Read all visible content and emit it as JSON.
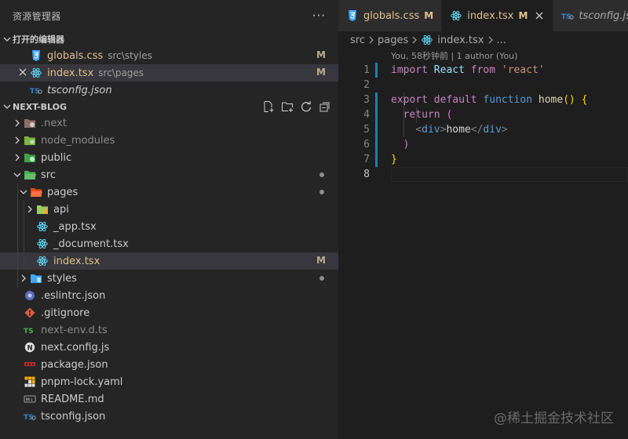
{
  "explorer": {
    "title": "资源管理器",
    "more": "···",
    "open_editors": {
      "label": "打开的编辑器",
      "items": [
        {
          "name": "globals.css",
          "desc": "src\\styles",
          "badge": "M",
          "icon": "css-file-icon"
        },
        {
          "name": "index.tsx",
          "desc": "src\\pages",
          "badge": "M",
          "icon": "react-file-icon"
        },
        {
          "name": "tsconfig.json",
          "desc": "",
          "badge": "",
          "icon": "ts-config-file-icon"
        }
      ]
    },
    "project": {
      "label": "NEXT-BLOG",
      "tree": [
        {
          "name": ".next",
          "kind": "folder"
        },
        {
          "name": "node_modules",
          "kind": "folder"
        },
        {
          "name": "public",
          "kind": "folder"
        },
        {
          "name": "src",
          "kind": "folder"
        },
        {
          "name": "pages",
          "kind": "folder"
        },
        {
          "name": "api",
          "kind": "folder"
        },
        {
          "name": "_app.tsx",
          "kind": "file"
        },
        {
          "name": "_document.tsx",
          "kind": "file"
        },
        {
          "name": "index.tsx",
          "kind": "file",
          "badge": "M"
        },
        {
          "name": "styles",
          "kind": "folder"
        },
        {
          "name": ".eslintrc.json",
          "kind": "file"
        },
        {
          "name": ".gitignore",
          "kind": "file"
        },
        {
          "name": "next-env.d.ts",
          "kind": "file"
        },
        {
          "name": "next.config.js",
          "kind": "file"
        },
        {
          "name": "package.json",
          "kind": "file"
        },
        {
          "name": "pnpm-lock.yaml",
          "kind": "file"
        },
        {
          "name": "README.md",
          "kind": "file"
        },
        {
          "name": "tsconfig.json",
          "kind": "file"
        }
      ]
    }
  },
  "editor": {
    "tabs": [
      {
        "name": "globals.css",
        "badge": "M"
      },
      {
        "name": "index.tsx",
        "badge": "M"
      },
      {
        "name": "tsconfig.json",
        "badge": ""
      }
    ],
    "breadcrumb": [
      "src",
      "pages",
      "index.tsx",
      "..."
    ],
    "codelens": "You, 58秒钟前 | 1 author (You)",
    "line_numbers": [
      "1",
      "2",
      "3",
      "4",
      "5",
      "6",
      "7",
      "8"
    ],
    "code": {
      "l1": {
        "kw": "import",
        "id": "React",
        "from": "from",
        "str": "'react'"
      },
      "l3": {
        "kw1": "export",
        "kw2": "default",
        "kw3": "function",
        "fn": "home",
        "paren": "()",
        "brace": "{"
      },
      "l4": {
        "kw": "return",
        "paren": "("
      },
      "l5": {
        "open_lt": "<",
        "tag": "div",
        "open_gt": ">",
        "text": "home",
        "close_lt": "</",
        "close_tag": "div",
        "close_gt": ">"
      },
      "l6": {
        "paren": ")"
      },
      "l7": {
        "brace": "}"
      }
    }
  },
  "watermark": "@稀土掘金技术社区",
  "colors": {
    "modified": "#e2c08d",
    "react": "#61dafb",
    "css": "#42a5f5",
    "ts": "#3b82c4",
    "git": "#e55b3c",
    "gutter_mod": "#1b81a8"
  }
}
